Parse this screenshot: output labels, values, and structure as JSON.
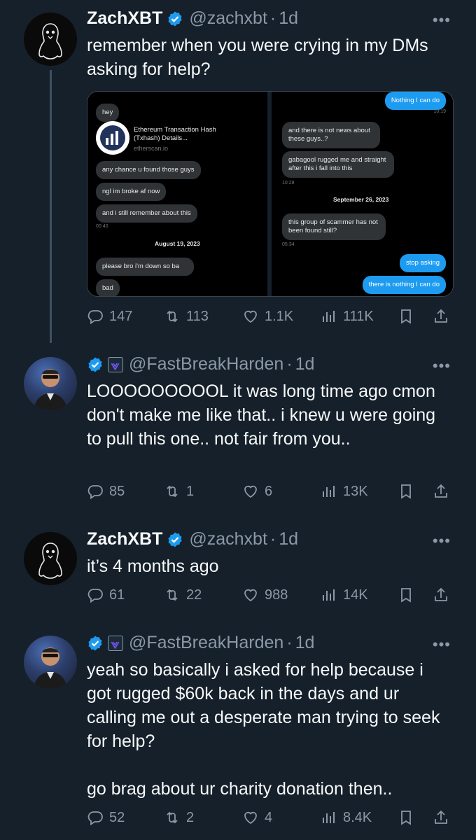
{
  "tweets": [
    {
      "name": "ZachXBT",
      "handle": "@zachxbt",
      "sep": "·",
      "time": "1d",
      "more": "•••",
      "text": "remember when you were crying in my DMs asking for help?",
      "stats": {
        "reply": "147",
        "retweet": "113",
        "like": "1.1K",
        "views": "111K"
      }
    },
    {
      "name": "",
      "handle": "@FastBreakHarden",
      "sep": "·",
      "time": "1d",
      "more": "•••",
      "text": "LOOOOOOOOOL it was long time ago cmon don't make me like that.. i knew u were going to pull this one.. not fair from you..",
      "stats": {
        "reply": "85",
        "retweet": "1",
        "like": "6",
        "views": "13K"
      }
    },
    {
      "name": "ZachXBT",
      "handle": "@zachxbt",
      "sep": "·",
      "time": "1d",
      "more": "•••",
      "text": "it’s 4 months ago",
      "stats": {
        "reply": "61",
        "retweet": "22",
        "like": "988",
        "views": "14K"
      }
    },
    {
      "name": "",
      "handle": "@FastBreakHarden",
      "sep": "·",
      "time": "1d",
      "more": "•••",
      "text": "yeah so basically i asked for help because i got rugged $60k back in the days and ur calling me out a desperate man trying to seek for help?\n\ngo brag about ur charity donation then..",
      "stats": {
        "reply": "52",
        "retweet": "2",
        "like": "4",
        "views": "8.4K"
      }
    }
  ],
  "dm_left": {
    "hey": "hey",
    "link_title": "Ethereum Transaction Hash (Txhash) Details...",
    "link_domain": "etherscan.io",
    "m1": "any chance u found those guys",
    "m2": "ngl im broke af now",
    "m3": "and i still remember about this",
    "time1": "00:40",
    "date1": "August 19, 2023",
    "m4": "please bro i'm down so ba",
    "m5": "bad"
  },
  "dm_right": {
    "r1": "Nothing I can do",
    "time_r1": "10:19",
    "l1": "and there is not news about these guys..?",
    "l2": "gabagool rugged me and straight after this i fall into this",
    "time_l2": "10:28",
    "date2": "September 26, 2023",
    "l3": "this group of scammer has not been found still?",
    "time_l3": "05:34",
    "r2": "stop asking",
    "r3": "there is nothing I can do"
  },
  "colors": {
    "bg": "#15202b",
    "text": "#f7f9f9",
    "muted": "#8b98a5",
    "accent": "#1d9bf0"
  },
  "icons": [
    "reply-icon",
    "retweet-icon",
    "like-icon",
    "views-icon",
    "bookmark-icon",
    "share-icon",
    "verified-icon",
    "more-icon"
  ]
}
